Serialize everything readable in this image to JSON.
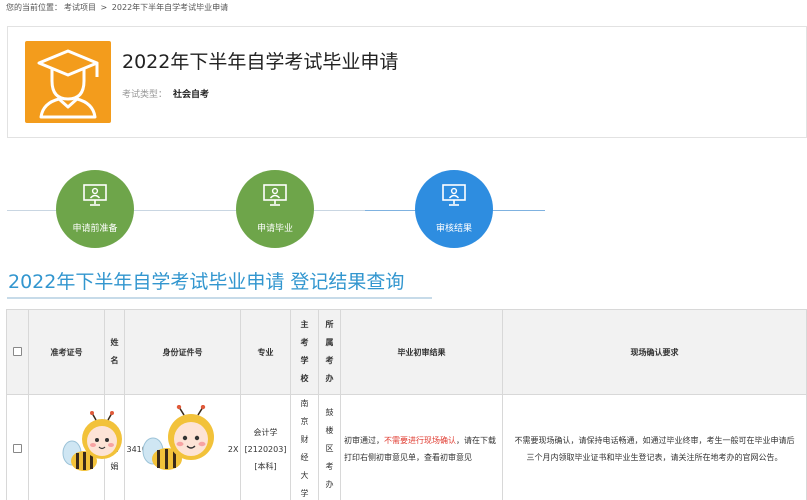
{
  "breadcrumb": {
    "prefix": "您的当前位置：",
    "items": [
      "考试项目",
      "2022年下半年自学考试毕业申请"
    ],
    "separator": ">"
  },
  "exam": {
    "title": "2022年下半年自学考试毕业申请",
    "type_label": "考试类型：",
    "type_value": "社会自考"
  },
  "steps": [
    {
      "label": "申请前准备",
      "icon": "monitor-user-icon",
      "color": "#6ea54a"
    },
    {
      "label": "申请毕业",
      "icon": "monitor-user-icon",
      "color": "#6ea54a"
    },
    {
      "label": "审核结果",
      "icon": "monitor-user-icon",
      "color": "#2e8de0"
    }
  ],
  "result": {
    "heading": "2022年下半年自学考试毕业申请 登记结果查询"
  },
  "table": {
    "headers": {
      "exam_no": "准考证号",
      "name": "姓名",
      "id_no": "身份证件号",
      "major": "专业",
      "school": "主考学校",
      "district": "所属考办",
      "first_review": "毕业初审结果",
      "onsite": "现场确认要求"
    },
    "row": {
      "exam_no_prefix": "0",
      "name": "汤惠娟",
      "id_prefix": "3410",
      "id_suffix": "2X",
      "major_name": "会计学",
      "major_code": "[2120203]",
      "major_level": "[本科]",
      "school": "南京财经大学",
      "district": "鼓楼区考办",
      "first_review_a": "初审通过，",
      "first_review_red": "不需要进行现场确认",
      "first_review_b": "，请在下载打印右侧初审意见单，查看初审意见",
      "onsite": "不需要现场确认，请保持电话畅通，如通过毕业终审，考生一般可在毕业申请后三个月内领取毕业证书和毕业生登记表，请关注所在地考办的官网公告。"
    }
  },
  "colors": {
    "logo_bg": "#f39c1c",
    "step_done": "#6ea54a",
    "step_current": "#2e8de0",
    "heading": "#3296cf",
    "alert": "#e03c31"
  }
}
